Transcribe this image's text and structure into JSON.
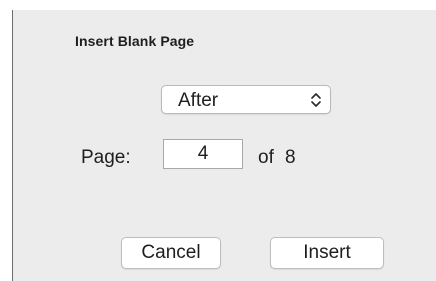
{
  "dialog": {
    "title": "Insert Blank Page",
    "position_select": {
      "value": "After",
      "icon": "up-down-chevron-icon"
    },
    "page_label": "Page:",
    "page_value": "4",
    "of_label": "of",
    "total_pages": "8",
    "cancel_label": "Cancel",
    "insert_label": "Insert"
  }
}
